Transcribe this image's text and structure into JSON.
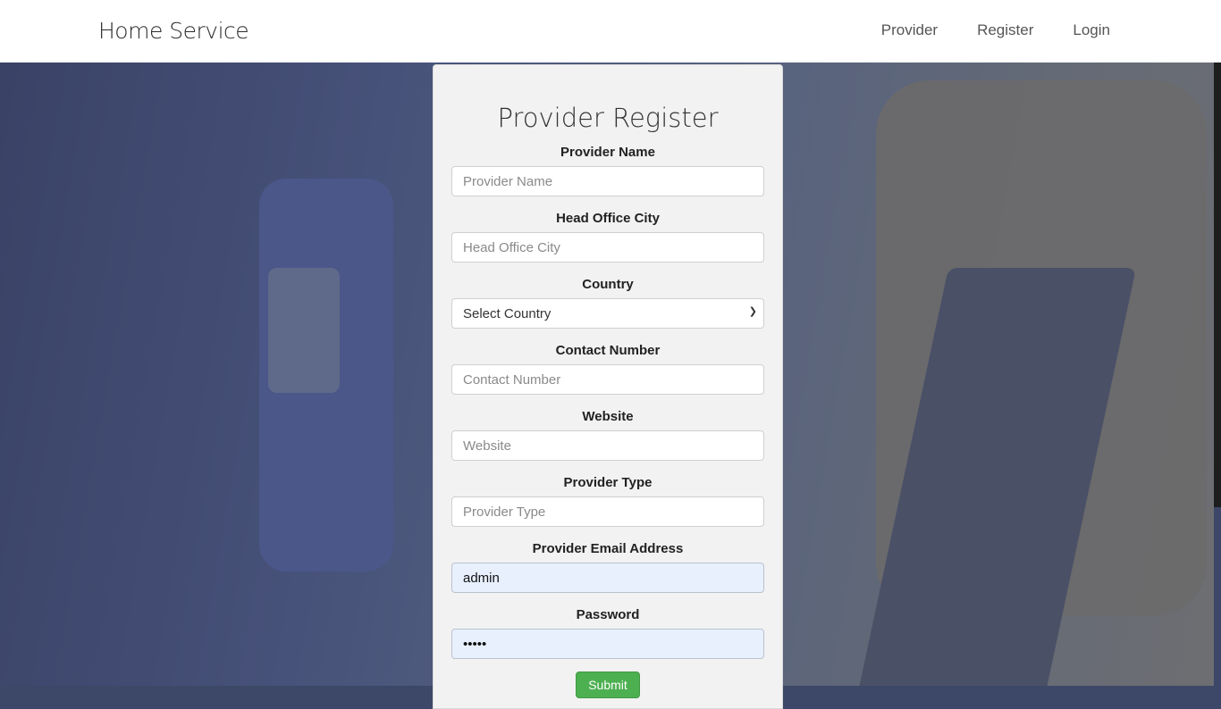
{
  "nav": {
    "brand": "Home Service",
    "links": [
      "Provider",
      "Register",
      "Login"
    ]
  },
  "form": {
    "title": "Provider Register",
    "fields": [
      {
        "label": "Provider Name",
        "placeholder": "Provider Name",
        "value": ""
      },
      {
        "label": "Head Office City",
        "placeholder": "Head Office City",
        "value": ""
      },
      {
        "label": "Country",
        "selected": "Select Country"
      },
      {
        "label": "Contact Number",
        "placeholder": "Contact Number",
        "value": ""
      },
      {
        "label": "Website",
        "placeholder": "Website",
        "value": ""
      },
      {
        "label": "Provider Type",
        "placeholder": "Provider Type",
        "value": ""
      },
      {
        "label": "Provider Email Address",
        "placeholder": "",
        "value": "admin"
      },
      {
        "label": "Password",
        "placeholder": "",
        "value": "admin"
      }
    ],
    "submit_label": "Submit"
  }
}
